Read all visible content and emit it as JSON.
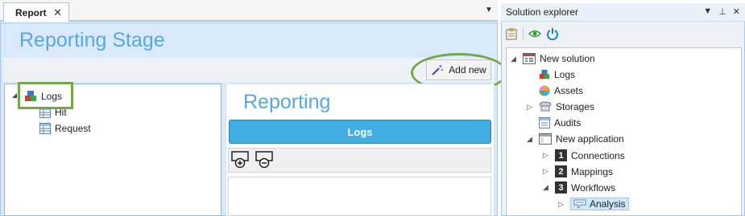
{
  "document": {
    "tab_label": "Report",
    "tab_close": "✕",
    "tab_menu": "▼",
    "stage_title": "Reporting Stage",
    "add_new_label": "Add new"
  },
  "tree": {
    "root": "Logs",
    "children": [
      "Hit",
      "Request"
    ]
  },
  "reporting": {
    "title": "Reporting",
    "logs_button": "Logs"
  },
  "solution_explorer": {
    "title": "Solution explorer",
    "pane_controls": [
      "▼",
      "⊥",
      "✕"
    ],
    "items": [
      {
        "label": "New solution",
        "icon": "solution-icon"
      },
      {
        "label": "Logs",
        "icon": "logs-icon"
      },
      {
        "label": "Assets",
        "icon": "assets-icon"
      },
      {
        "label": "Storages",
        "icon": "storages-icon"
      },
      {
        "label": "Audits",
        "icon": "audits-icon"
      },
      {
        "label": "New application",
        "icon": "application-icon"
      },
      {
        "label": "Connections",
        "number": "1"
      },
      {
        "label": "Mappings",
        "number": "2"
      },
      {
        "label": "Workflows",
        "number": "3"
      },
      {
        "label": "Analysis",
        "icon": "analysis-icon"
      }
    ]
  }
}
